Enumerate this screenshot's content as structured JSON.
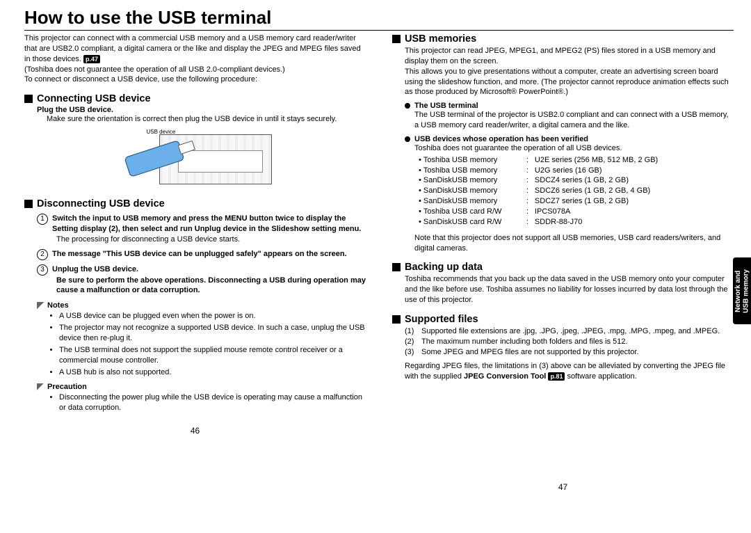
{
  "title": "How to use the USB terminal",
  "intro1": "This projector can connect with a commercial USB memory and a USB memory card reader/writer that are USB2.0 compliant, a digital camera or the like and display the JPEG and MPEG files saved in those devices.",
  "intro_badge": "p.47",
  "intro2": "(Toshiba does not guarantee the operation of all USB 2.0-compliant devices.)",
  "intro3": "To connect or disconnect a USB device, use the following procedure:",
  "left": {
    "sec1": "Connecting USB device",
    "sec1_sub": "Plug the USB device.",
    "sec1_body": "Make sure the orientation is correct then plug the USB device in until it stays securely.",
    "fig_label": "USB device",
    "sec2": "Disconnecting USB device",
    "step1": "Switch the input to USB memory and press the MENU button twice to display the Setting display (2), then select and run Unplug device in the Slideshow setting menu.",
    "step1_body": "The processing for disconnecting a USB device starts.",
    "step2": "The message \"This USB device can be unplugged safely\" appears on the screen.",
    "step3": "Unplug the USB device.",
    "step3_body": "Be sure to perform the above operations. Disconnecting a USB during operation may cause a malfunction or data corruption.",
    "notes_h": "Notes",
    "note1": "A USB device can be plugged even when the power is on.",
    "note2": "The projector may not recognize a supported USB device. In such a case, unplug the USB device then re-plug it.",
    "note3": "The USB terminal does not support the supplied mouse remote control receiver or a commercial mouse controller.",
    "note4": "A USB hub is also not supported.",
    "prec_h": "Precaution",
    "prec1": "Disconnecting the power plug while the USB device is operating may cause a malfunction or data corruption."
  },
  "right": {
    "sec1": "USB memories",
    "sec1_body": "This projector can read JPEG, MPEG1, and MPEG2 (PS) files stored in a USB memory and display them on the screen.",
    "sec1_body2": "This allows you to give presentations without a computer, create an advertising screen board using the slideshow function, and more. (The projector cannot reproduce animation effects such as those produced by Microsoft® PowerPoint®.)",
    "sub1": "The USB terminal",
    "sub1_body": "The USB terminal of the projector is USB2.0 compliant and can connect with a USB memory, a USB memory card reader/writer, a digital camera and the like.",
    "sub2": "USB devices whose operation has been verified",
    "sub2_body": "Toshiba does not guarantee the operation of all USB devices.",
    "devices": [
      {
        "n": "Toshiba USB memory",
        "v": "U2E series (256 MB, 512 MB, 2 GB)"
      },
      {
        "n": "Toshiba USB memory",
        "v": "U2G series (16 GB)"
      },
      {
        "n": "SanDiskUSB memory",
        "v": "SDCZ4 series (1 GB, 2 GB)"
      },
      {
        "n": "SanDiskUSB memory",
        "v": "SDCZ6 series (1 GB, 2 GB, 4 GB)"
      },
      {
        "n": "SanDiskUSB memory",
        "v": "SDCZ7 series (1 GB, 2 GB)"
      },
      {
        "n": "Toshiba USB card R/W",
        "v": "IPCS078A"
      },
      {
        "n": "SanDiskUSB card R/W",
        "v": "SDDR-88-J70"
      }
    ],
    "sub2_note": "Note that this projector does not support all USB memories, USB card readers/writers, and digital cameras.",
    "sec2": "Backing up data",
    "sec2_body": "Toshiba recommends that you back up the data saved in the USB memory onto your computer and the like before use. Toshiba assumes no liability for losses incurred by data lost through the use of this projector.",
    "sec3": "Supported files",
    "supp1": "Supported file extensions are .jpg, .JPG, .jpeg, .JPEG, .mpg, .MPG, .mpeg, and .MPEG.",
    "supp2": "The maximum number including both folders and files is 512.",
    "supp3": "Some JPEG and MPEG files are not supported by this projector.",
    "sec3_body2a": "Regarding JPEG files, the limitations in (3) above can be alleviated by converting the JPEG file with the supplied ",
    "sec3_tool": "JPEG Conversion Tool",
    "sec3_badge": "p.81",
    "sec3_body2b": " software application."
  },
  "pagenum_left": "46",
  "pagenum_right": "47",
  "sidetab": "Network and\nUSB memory"
}
